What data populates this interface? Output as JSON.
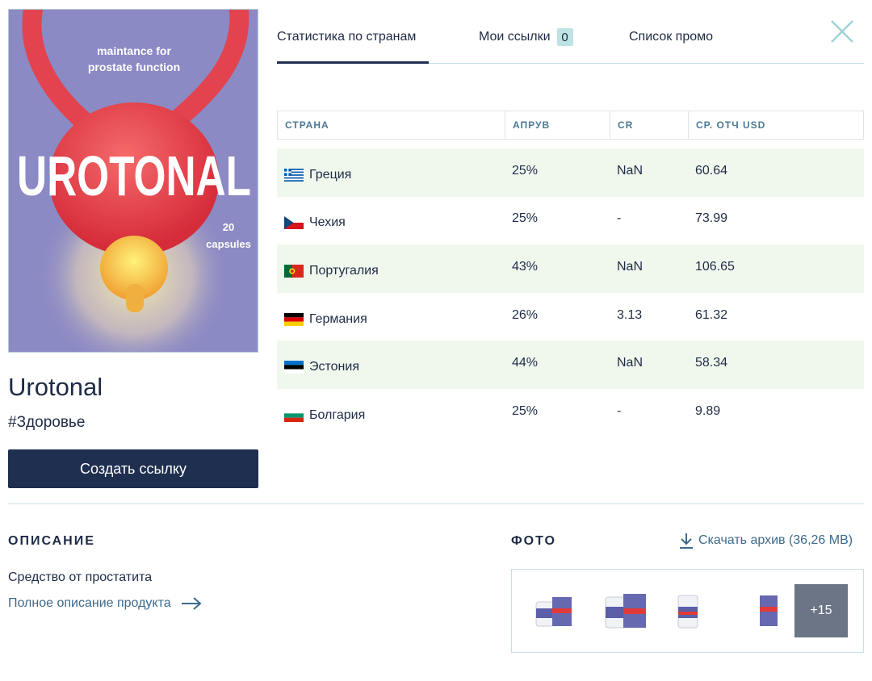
{
  "product": {
    "name": "Urotonal",
    "tag": "#Здоровье",
    "create_link_label": "Создать ссылку",
    "image": {
      "brand": "UROTONAL",
      "line1": "maintance for",
      "line2": "prostate function",
      "count_num": "20",
      "count_label": "capsules"
    }
  },
  "tabs": [
    {
      "label": "Статистика по странам",
      "active": true
    },
    {
      "label": "Мои ссылки",
      "badge": "0"
    },
    {
      "label": "Список промо"
    }
  ],
  "table": {
    "headers": [
      "СТРАНА",
      "АПРУВ",
      "CR",
      "СР. ОТЧ USD"
    ],
    "rows": [
      {
        "country": "Греция",
        "flag": "greece-flag-icon",
        "approve": "25%",
        "cr": "NaN",
        "avg": "60.64"
      },
      {
        "country": "Чехия",
        "flag": "czech-flag-icon",
        "approve": "25%",
        "cr": "-",
        "avg": "73.99"
      },
      {
        "country": "Португалия",
        "flag": "portugal-flag-icon",
        "approve": "43%",
        "cr": "NaN",
        "avg": "106.65"
      },
      {
        "country": "Германия",
        "flag": "germany-flag-icon",
        "approve": "26%",
        "cr": "3.13",
        "avg": "61.32"
      },
      {
        "country": "Эстония",
        "flag": "estonia-flag-icon",
        "approve": "44%",
        "cr": "NaN",
        "avg": "58.34"
      },
      {
        "country": "Болгария",
        "flag": "bulgaria-flag-icon",
        "approve": "25%",
        "cr": "-",
        "avg": "9.89"
      }
    ]
  },
  "description": {
    "title": "ОПИСАНИЕ",
    "text": "Средство от простатита",
    "full_link": "Полное описание продукта"
  },
  "photos": {
    "title": "ФОТО",
    "download_label": "Скачать архив (36,26 MB)",
    "more_label": "+15"
  },
  "colors": {
    "primary": "#1f2f4f",
    "accent": "#3d6a8c",
    "row_stripe": "#f0f8ee",
    "badge": "#bfe2e4"
  }
}
